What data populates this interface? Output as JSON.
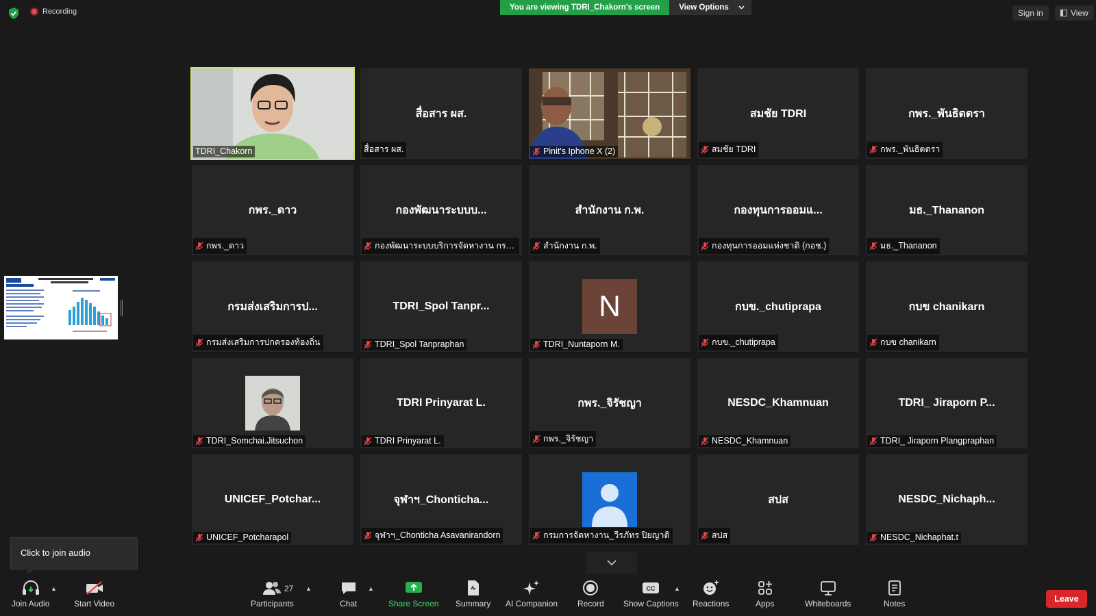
{
  "topbar": {
    "recording_label": "Recording",
    "viewing_banner": "You are viewing TDRI_Chakorn's screen",
    "view_options": "View Options",
    "sign_in": "Sign in",
    "view": "View"
  },
  "colors": {
    "active_speaker_border": "#c8e65a",
    "banner_green": "#23a047",
    "leave_red": "#d9262b",
    "share_green": "#3ddc6a"
  },
  "tiles": [
    {
      "center": "",
      "label": "TDRI_Chakorn",
      "muted": false,
      "kind": "video-person"
    },
    {
      "center": "สื่อสาร ผส.",
      "label": "สื่อสาร ผส.",
      "muted": false,
      "kind": "name"
    },
    {
      "center": "",
      "label": "Pinit's Iphone X (2)",
      "muted": true,
      "kind": "video-room"
    },
    {
      "center": "สมชัย TDRI",
      "label": "สมชัย TDRI",
      "muted": true,
      "kind": "name"
    },
    {
      "center": "กพร._พันธิตตรา",
      "label": "กพร._พันธิตตรา",
      "muted": true,
      "kind": "name"
    },
    {
      "center": "กพร._ดาว",
      "label": "กพร._ดาว",
      "muted": true,
      "kind": "name"
    },
    {
      "center": "กองพัฒนาระบบบ...",
      "label": "กองพัฒนาระบบบริการจัดหางาน กรมการจ...",
      "muted": true,
      "kind": "name"
    },
    {
      "center": "สำนักงาน ก.พ.",
      "label": "สำนักงาน ก.พ.",
      "muted": true,
      "kind": "name"
    },
    {
      "center": "กองทุนการออมแ...",
      "label": "กองทุนการออมแห่งชาติ (กอช.)",
      "muted": true,
      "kind": "name"
    },
    {
      "center": "มธ._Thananon",
      "label": "มธ._Thananon",
      "muted": true,
      "kind": "name"
    },
    {
      "center": "กรมส่งเสริมการป...",
      "label": "กรมส่งเสริมการปกครองท้องถิ่น",
      "muted": true,
      "kind": "name"
    },
    {
      "center": "TDRI_Spol  Tanpr...",
      "label": "TDRI_Spol Tanpraphan",
      "muted": true,
      "kind": "name"
    },
    {
      "center": "N",
      "label": "TDRI_Nuntaporn M.",
      "muted": true,
      "kind": "avatar-letter"
    },
    {
      "center": "กบข._chutiprapa",
      "label": "กบข._chutiprapa",
      "muted": true,
      "kind": "name"
    },
    {
      "center": "กบข chanikarn",
      "label": "กบข chanikarn",
      "muted": true,
      "kind": "name"
    },
    {
      "center": "",
      "label": "TDRI_Somchai.Jitsuchon",
      "muted": true,
      "kind": "avatar-photo"
    },
    {
      "center": "TDRI Prinyarat L.",
      "label": "TDRI Prinyarat L.",
      "muted": true,
      "kind": "name"
    },
    {
      "center": "กพร._จิรัชญา",
      "label": "กพร._จิรัชญา",
      "muted": true,
      "kind": "name"
    },
    {
      "center": "NESDC_Khamnuan",
      "label": "NESDC_Khamnuan",
      "muted": true,
      "kind": "name"
    },
    {
      "center": "TDRI_ Jiraporn P...",
      "label": "TDRI_ Jiraporn Plangpraphan",
      "muted": true,
      "kind": "name"
    },
    {
      "center": "UNICEF_Potchar...",
      "label": "UNICEF_Potcharapol",
      "muted": true,
      "kind": "name"
    },
    {
      "center": "จุฬาฯ_Chonticha...",
      "label": "จุฬาฯ_Chonticha Asavanirandorn",
      "muted": true,
      "kind": "name"
    },
    {
      "center": "",
      "label": "กรมการจัดหางาน_วีรภัทร ปิยญาติ",
      "muted": true,
      "kind": "avatar-person"
    },
    {
      "center": "สปส",
      "label": "สปส",
      "muted": true,
      "kind": "name"
    },
    {
      "center": "NESDC_Nichaph...",
      "label": "NESDC_Nichaphat.t",
      "muted": true,
      "kind": "name"
    }
  ],
  "join_audio_tip": "Click to join audio",
  "toolbar": {
    "join_audio": "Join Audio",
    "start_video": "Start Video",
    "participants": "Participants",
    "participants_count": "27",
    "chat": "Chat",
    "share_screen": "Share Screen",
    "summary": "Summary",
    "ai_companion": "AI Companion",
    "record": "Record",
    "show_captions": "Show Captions",
    "reactions": "Reactions",
    "apps": "Apps",
    "whiteboards": "Whiteboards",
    "notes": "Notes",
    "leave": "Leave"
  }
}
